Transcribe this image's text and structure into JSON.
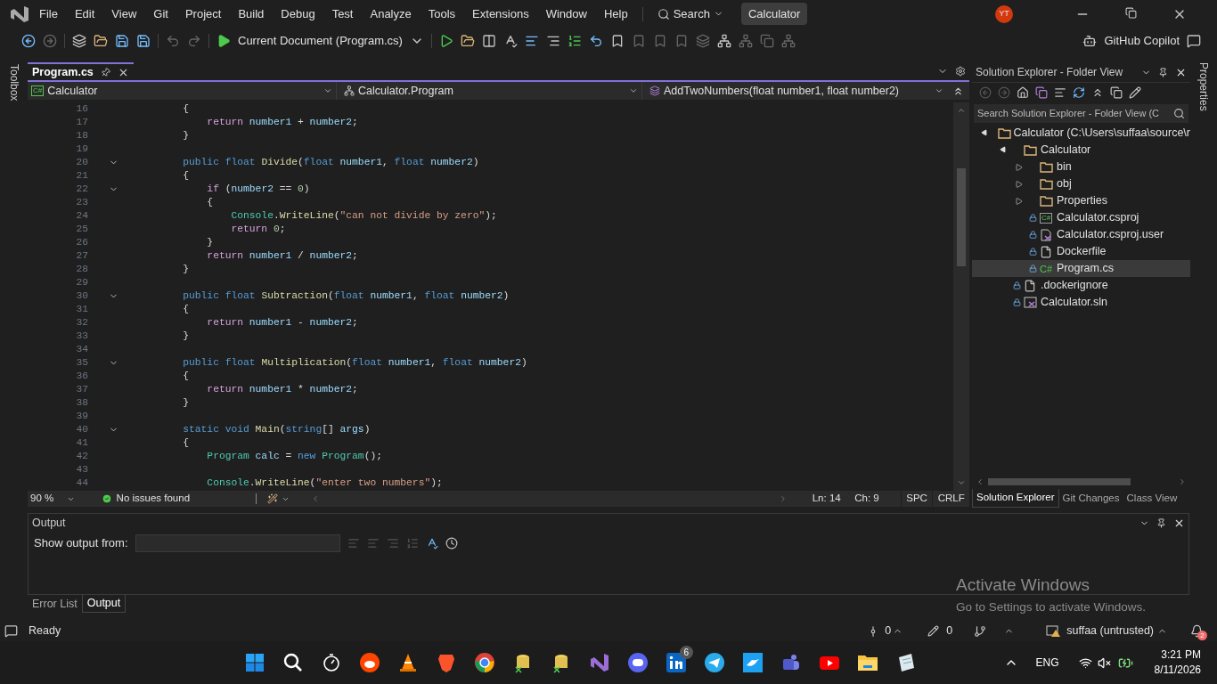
{
  "menu_bar": {
    "items": [
      "File",
      "Edit",
      "View",
      "Git",
      "Project",
      "Build",
      "Debug",
      "Test",
      "Analyze",
      "Tools",
      "Extensions",
      "Window",
      "Help"
    ],
    "search": "Search",
    "solution_name": "Calculator",
    "avatar": "YT"
  },
  "toolbar": {
    "run_target": "Current Document (Program.cs)",
    "copilot": "GitHub Copilot"
  },
  "side_tabs": {
    "left": "Toolbox",
    "right": "Properties"
  },
  "editor": {
    "tabs": [
      {
        "label": "Program.cs",
        "selected": true
      }
    ],
    "nav": {
      "project_icon": "C#",
      "project": "Calculator",
      "class": "Calculator.Program",
      "member": "AddTwoNumbers(float number1, float number2)"
    },
    "lines": [
      {
        "number": "16",
        "fold": false,
        "tokens": [
          {
            "kind": "p",
            "text": "        {"
          }
        ]
      },
      {
        "number": "17",
        "fold": false,
        "tokens": [
          {
            "kind": "ctl",
            "text": "            return"
          },
          {
            "kind": "id",
            "text": " number1"
          },
          {
            "kind": "p",
            "text": " + "
          },
          {
            "kind": "id",
            "text": "number2"
          },
          {
            "kind": "p",
            "text": ";"
          }
        ]
      },
      {
        "number": "18",
        "fold": false,
        "tokens": [
          {
            "kind": "p",
            "text": "        }"
          }
        ]
      },
      {
        "number": "19",
        "fold": false
      },
      {
        "number": "20",
        "fold": true,
        "tokens": [
          {
            "kind": "kw",
            "text": "        public float "
          },
          {
            "kind": "m",
            "text": "Divide"
          },
          {
            "kind": "p",
            "text": "("
          },
          {
            "kind": "kw",
            "text": "float "
          },
          {
            "kind": "id",
            "text": "number1"
          },
          {
            "kind": "p",
            "text": ", "
          },
          {
            "kind": "kw",
            "text": "float "
          },
          {
            "kind": "id",
            "text": "number2"
          },
          {
            "kind": "p",
            "text": ")"
          }
        ]
      },
      {
        "number": "21",
        "fold": false,
        "tokens": [
          {
            "kind": "p",
            "text": "        {"
          }
        ]
      },
      {
        "number": "22",
        "fold": true,
        "tokens": [
          {
            "kind": "ctl",
            "text": "            if"
          },
          {
            "kind": "p",
            "text": " ("
          },
          {
            "kind": "id",
            "text": "number2"
          },
          {
            "kind": "p",
            "text": " == "
          },
          {
            "kind": "num",
            "text": "0"
          },
          {
            "kind": "p",
            "text": ")"
          }
        ]
      },
      {
        "number": "23",
        "fold": false,
        "tokens": [
          {
            "kind": "p",
            "text": "            {"
          }
        ]
      },
      {
        "number": "24",
        "fold": false,
        "tokens": [
          {
            "kind": "type",
            "text": "                Console"
          },
          {
            "kind": "p",
            "text": "."
          },
          {
            "kind": "m",
            "text": "WriteLine"
          },
          {
            "kind": "p",
            "text": "("
          },
          {
            "kind": "str",
            "text": "\"can not divide by zero\""
          },
          {
            "kind": "p",
            "text": ");"
          }
        ]
      },
      {
        "number": "25",
        "fold": false,
        "tokens": [
          {
            "kind": "ctl",
            "text": "                return "
          },
          {
            "kind": "num",
            "text": "0"
          },
          {
            "kind": "p",
            "text": ";"
          }
        ]
      },
      {
        "number": "26",
        "fold": false,
        "tokens": [
          {
            "kind": "p",
            "text": "            }"
          }
        ]
      },
      {
        "number": "27",
        "fold": false,
        "tokens": [
          {
            "kind": "ctl",
            "text": "            return"
          },
          {
            "kind": "id",
            "text": " number1"
          },
          {
            "kind": "p",
            "text": " / "
          },
          {
            "kind": "id",
            "text": "number2"
          },
          {
            "kind": "p",
            "text": ";"
          }
        ]
      },
      {
        "number": "28",
        "fold": false,
        "tokens": [
          {
            "kind": "p",
            "text": "        }"
          }
        ]
      },
      {
        "number": "29",
        "fold": false
      },
      {
        "number": "30",
        "fold": true,
        "tokens": [
          {
            "kind": "kw",
            "text": "        public float "
          },
          {
            "kind": "m",
            "text": "Subtraction"
          },
          {
            "kind": "p",
            "text": "("
          },
          {
            "kind": "kw",
            "text": "float "
          },
          {
            "kind": "id",
            "text": "number1"
          },
          {
            "kind": "p",
            "text": ", "
          },
          {
            "kind": "kw",
            "text": "float "
          },
          {
            "kind": "id",
            "text": "number2"
          },
          {
            "kind": "p",
            "text": ")"
          }
        ]
      },
      {
        "number": "31",
        "fold": false,
        "tokens": [
          {
            "kind": "p",
            "text": "        {"
          }
        ]
      },
      {
        "number": "32",
        "fold": false,
        "tokens": [
          {
            "kind": "ctl",
            "text": "            return"
          },
          {
            "kind": "id",
            "text": " number1"
          },
          {
            "kind": "p",
            "text": " - "
          },
          {
            "kind": "id",
            "text": "number2"
          },
          {
            "kind": "p",
            "text": ";"
          }
        ]
      },
      {
        "number": "33",
        "fold": false,
        "tokens": [
          {
            "kind": "p",
            "text": "        }"
          }
        ]
      },
      {
        "number": "34",
        "fold": false
      },
      {
        "number": "35",
        "fold": true,
        "tokens": [
          {
            "kind": "kw",
            "text": "        public float "
          },
          {
            "kind": "m",
            "text": "Multiplication"
          },
          {
            "kind": "p",
            "text": "("
          },
          {
            "kind": "kw",
            "text": "float "
          },
          {
            "kind": "id",
            "text": "number1"
          },
          {
            "kind": "p",
            "text": ", "
          },
          {
            "kind": "kw",
            "text": "float "
          },
          {
            "kind": "id",
            "text": "number2"
          },
          {
            "kind": "p",
            "text": ")"
          }
        ]
      },
      {
        "number": "36",
        "fold": false,
        "tokens": [
          {
            "kind": "p",
            "text": "        {"
          }
        ]
      },
      {
        "number": "37",
        "fold": false,
        "tokens": [
          {
            "kind": "ctl",
            "text": "            return"
          },
          {
            "kind": "id",
            "text": " number1"
          },
          {
            "kind": "p",
            "text": " * "
          },
          {
            "kind": "id",
            "text": "number2"
          },
          {
            "kind": "p",
            "text": ";"
          }
        ]
      },
      {
        "number": "38",
        "fold": false,
        "tokens": [
          {
            "kind": "p",
            "text": "        }"
          }
        ]
      },
      {
        "number": "39",
        "fold": false
      },
      {
        "number": "40",
        "fold": true,
        "tokens": [
          {
            "kind": "kw",
            "text": "        static void "
          },
          {
            "kind": "m",
            "text": "Main"
          },
          {
            "kind": "p",
            "text": "("
          },
          {
            "kind": "kw",
            "text": "string"
          },
          {
            "kind": "p",
            "text": "[] "
          },
          {
            "kind": "id",
            "text": "args"
          },
          {
            "kind": "p",
            "text": ")"
          }
        ]
      },
      {
        "number": "41",
        "fold": false,
        "tokens": [
          {
            "kind": "p",
            "text": "        {"
          }
        ]
      },
      {
        "number": "42",
        "fold": false,
        "tokens": [
          {
            "kind": "type",
            "text": "            Program"
          },
          {
            "kind": "id",
            "text": " calc"
          },
          {
            "kind": "p",
            "text": " = "
          },
          {
            "kind": "kw",
            "text": "new "
          },
          {
            "kind": "type",
            "text": "Program"
          },
          {
            "kind": "p",
            "text": "();"
          }
        ]
      },
      {
        "number": "43",
        "fold": false
      },
      {
        "number": "44",
        "fold": false,
        "tokens": [
          {
            "kind": "type",
            "text": "            Console"
          },
          {
            "kind": "p",
            "text": "."
          },
          {
            "kind": "m",
            "text": "WriteLine"
          },
          {
            "kind": "p",
            "text": "("
          },
          {
            "kind": "str",
            "text": "\"enter two numbers\""
          },
          {
            "kind": "p",
            "text": ");"
          }
        ]
      }
    ],
    "status": {
      "zoom": "90 %",
      "issues": "No issues found",
      "line": "Ln: 14",
      "col": "Ch: 9",
      "indent": "SPC",
      "eol": "CRLF"
    }
  },
  "solution_explorer": {
    "title": "Solution Explorer - Folder View",
    "search_placeholder": "Search Solution Explorer - Folder View (C",
    "tree": [
      {
        "label": "Calculator (C:\\Users\\suffaa\\source\\r",
        "kind": "folder",
        "expanded": true,
        "selected": false,
        "children": [
          {
            "label": "Calculator",
            "kind": "folder",
            "expanded": true,
            "selected": false,
            "children": [
              {
                "label": "bin",
                "kind": "folder",
                "expanded": false,
                "selected": false
              },
              {
                "label": "obj",
                "kind": "folder",
                "expanded": false,
                "selected": false
              },
              {
                "label": "Properties",
                "kind": "folder",
                "expanded": false,
                "selected": false
              },
              {
                "label": "Calculator.csproj",
                "kind": "csproj",
                "icon_text": "C#",
                "locked": true,
                "selected": false
              },
              {
                "label": "Calculator.csproj.user",
                "kind": "user",
                "locked": true,
                "selected": false
              },
              {
                "label": "Dockerfile",
                "kind": "file",
                "locked": true,
                "selected": false
              },
              {
                "label": "Program.cs",
                "kind": "cs",
                "icon_text": "C#",
                "locked": true,
                "selected": true
              }
            ]
          },
          {
            "label": ".dockerignore",
            "kind": "file",
            "locked": true,
            "selected": false
          },
          {
            "label": "Calculator.sln",
            "kind": "sln",
            "locked": true,
            "selected": false
          }
        ]
      }
    ],
    "tabs": [
      {
        "label": "Solution Explorer",
        "selected": true
      },
      {
        "label": "Git Changes",
        "selected": false
      },
      {
        "label": "Class View",
        "selected": false
      }
    ]
  },
  "output": {
    "title": "Output",
    "label": "Show output from:",
    "tabs": [
      {
        "label": "Error List",
        "selected": false
      },
      {
        "label": "Output",
        "selected": true
      }
    ]
  },
  "status_bar": {
    "text": "Ready",
    "commits": "0",
    "edits": "0",
    "user": "suffaa (untrusted)",
    "notifications": "2"
  },
  "activation": {
    "title": "Activate Windows",
    "text": "Go to Settings to activate Windows."
  },
  "taskbar": {
    "badge": "6",
    "language": "ENG",
    "time": "3:21 PM",
    "date": "8/11/2026"
  }
}
